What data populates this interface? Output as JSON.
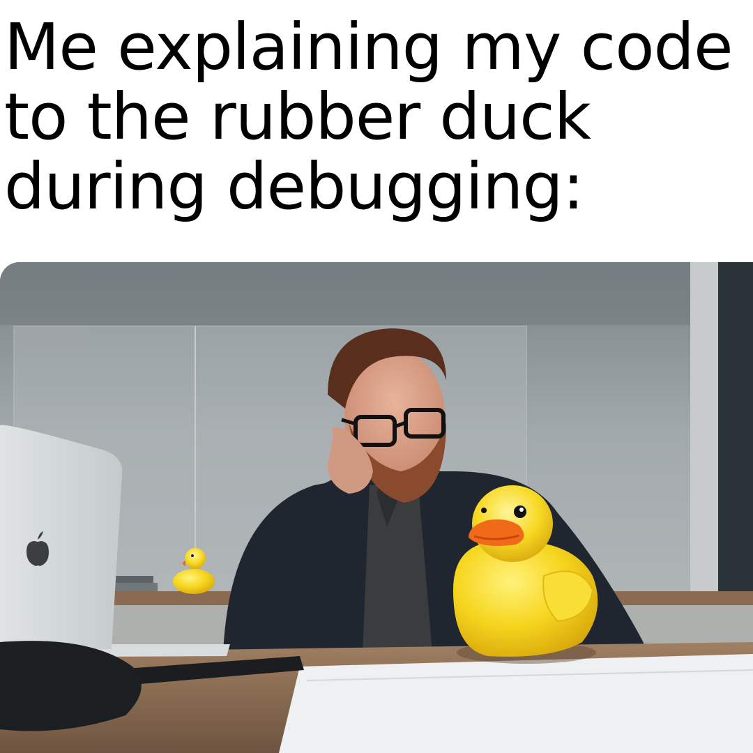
{
  "caption": {
    "line1": "Me explaining my code",
    "line2": "to the rubber duck",
    "line3": "during debugging:"
  },
  "photo": {
    "subject": "man-at-desk-with-rubber-duck",
    "icons": [
      "apple-logo-icon",
      "rubber-duck",
      "small-rubber-duck"
    ]
  },
  "colors": {
    "background": "#ffffff",
    "caption_text": "#000000",
    "duck_yellow": "#f7d823",
    "duck_beak": "#f06a1a",
    "wall": "#a9aeb0",
    "desk": "#8a6a4f",
    "jacket": "#1f2630"
  }
}
